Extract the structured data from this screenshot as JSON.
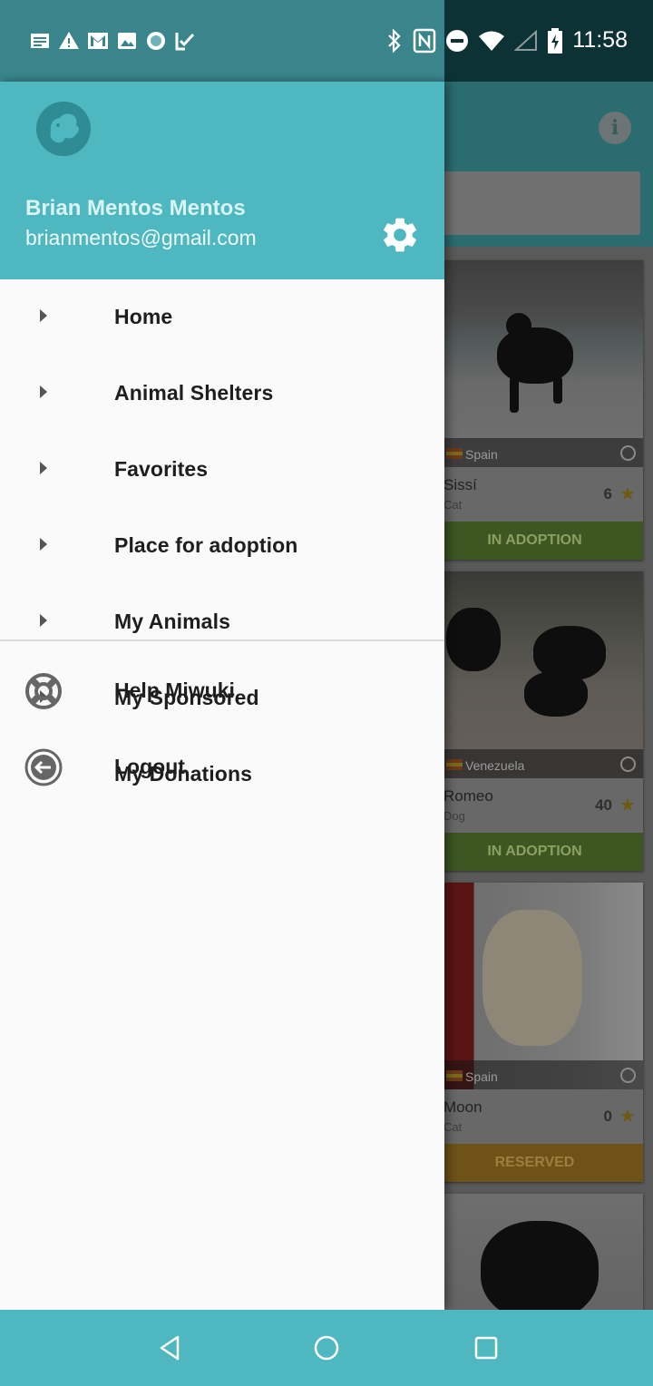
{
  "status_bar": {
    "time": "11:58",
    "left_icons": [
      "news-icon",
      "warning-icon",
      "gmail-icon",
      "image-icon",
      "circle-app-icon",
      "checkmark-app-icon"
    ],
    "right_icons": [
      "bluetooth-icon",
      "nfc-icon",
      "do-not-disturb-icon",
      "wifi-icon",
      "cell-signal-icon",
      "battery-charging-icon"
    ]
  },
  "drawer": {
    "user_name": "Brian Mentos Mentos",
    "user_email": "brianmentos@gmail.com",
    "menu_items": [
      {
        "label": "Home"
      },
      {
        "label": "Animal Shelters"
      },
      {
        "label": "Favorites"
      },
      {
        "label": "Place for adoption"
      },
      {
        "label": "My Animals"
      },
      {
        "label": "My Sponsored"
      },
      {
        "label": "My Donations"
      }
    ],
    "secondary_items": [
      {
        "label": "Help Miwuki",
        "icon": "lifebuoy-icon"
      },
      {
        "label": "Logout",
        "icon": "logout-icon"
      }
    ]
  },
  "background_list": {
    "cards": [
      {
        "country": "Spain",
        "name": "Sissí",
        "type": "Cat",
        "score": "6",
        "status": "IN ADOPTION"
      },
      {
        "country": "Venezuela",
        "name": "Romeo",
        "type": "Dog",
        "score": "40",
        "status": "IN ADOPTION"
      },
      {
        "country": "Spain",
        "name": "Moon",
        "type": "Cat",
        "score": "0",
        "status": "RESERVED"
      }
    ]
  },
  "colors": {
    "drawer_header": "#4fb7c0",
    "status_bar": "#3a858c",
    "nav_bar": "#4fb7c0",
    "adoption_status": "#8bc34a",
    "reserved_status": "#f5a623"
  }
}
